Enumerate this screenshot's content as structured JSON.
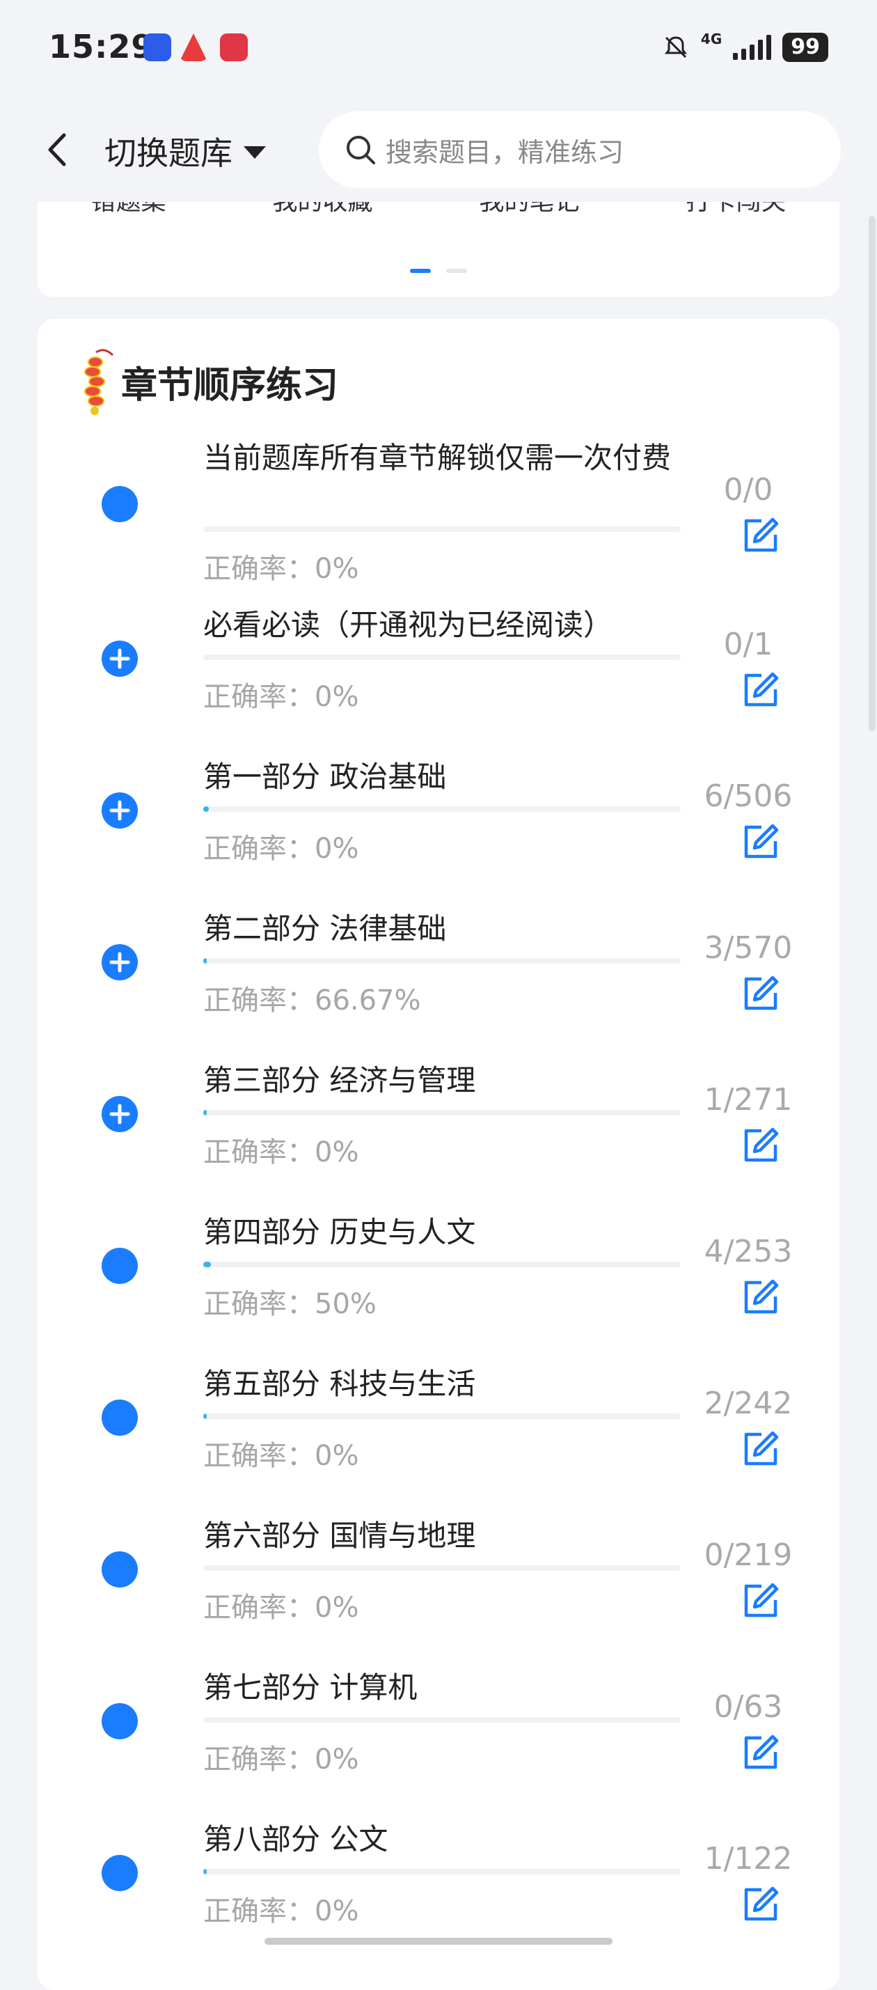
{
  "status_bar": {
    "time": "15:29",
    "network": "4G",
    "battery": "99"
  },
  "header": {
    "switch_label": "切换题库",
    "search_placeholder": "搜索题目，精准练习"
  },
  "top_tools": {
    "items": [
      "错题集",
      "我的收藏",
      "我的笔记",
      "打卡闯关"
    ]
  },
  "section": {
    "title": "章节顺序练习"
  },
  "chapters": [
    {
      "title": "当前题库所有章节解锁仅需一次付费",
      "accuracy": "正确率：0%",
      "count": "0/0",
      "progress": 0,
      "expandable": false
    },
    {
      "title": "必看必读（开通视为已经阅读）",
      "accuracy": "正确率：0%",
      "count": "0/1",
      "progress": 0,
      "expandable": true
    },
    {
      "title": "第一部分 政治基础",
      "accuracy": "正确率：0%",
      "count": "6/506",
      "progress": 0.012,
      "expandable": true
    },
    {
      "title": "第二部分 法律基础",
      "accuracy": "正确率：66.67%",
      "count": "3/570",
      "progress": 0.005,
      "expandable": true
    },
    {
      "title": "第三部分 经济与管理",
      "accuracy": "正确率：0%",
      "count": "1/271",
      "progress": 0.004,
      "expandable": true
    },
    {
      "title": "第四部分 历史与人文",
      "accuracy": "正确率：50%",
      "count": "4/253",
      "progress": 0.016,
      "expandable": false
    },
    {
      "title": "第五部分 科技与生活",
      "accuracy": "正确率：0%",
      "count": "2/242",
      "progress": 0.008,
      "expandable": false
    },
    {
      "title": "第六部分 国情与地理",
      "accuracy": "正确率：0%",
      "count": "0/219",
      "progress": 0,
      "expandable": false
    },
    {
      "title": "第七部分 计算机",
      "accuracy": "正确率：0%",
      "count": "0/63",
      "progress": 0,
      "expandable": false
    },
    {
      "title": "第八部分 公文",
      "accuracy": "正确率：0%",
      "count": "1/122",
      "progress": 0.008,
      "expandable": false
    }
  ],
  "colors": {
    "accent": "#1a7cff",
    "progress": "#36b4e8",
    "muted": "#a6a6a6"
  },
  "icons": {
    "back": "chevron-left-icon",
    "search": "search-icon",
    "edit": "edit-icon",
    "expand": "plus-circle-icon"
  }
}
